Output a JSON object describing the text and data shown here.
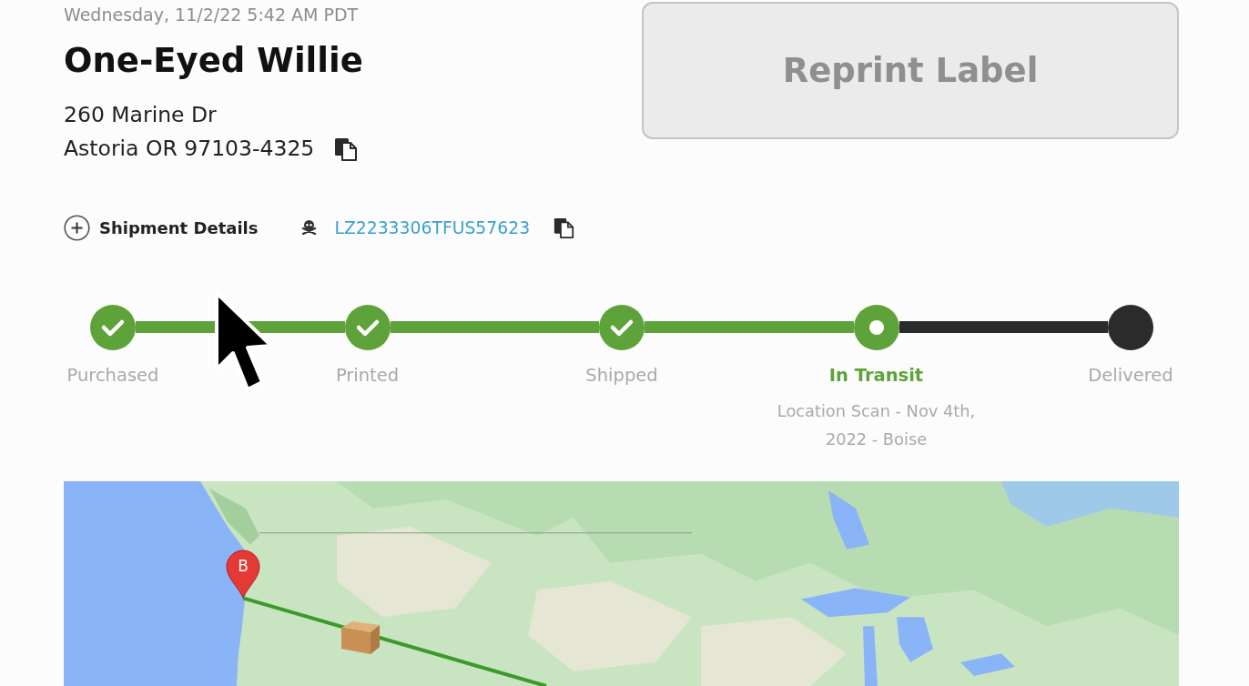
{
  "header": {
    "timestamp": "Wednesday, 11/2/22 5:42 AM PDT",
    "recipient": "One-Eyed Willie",
    "address_lines": [
      "260 Marine Dr",
      "Astoria OR 97103-4325"
    ]
  },
  "reprint_button": {
    "label": "Reprint Label",
    "disabled": true
  },
  "shipment_details": {
    "label": "Shipment Details",
    "expanded": false
  },
  "tracking_number": "LZ2233306TFUS57623",
  "progress": [
    {
      "label": "Purchased",
      "completed": true,
      "current": false
    },
    {
      "label": "Printed",
      "completed": true,
      "current": false
    },
    {
      "label": "Shipped",
      "completed": true,
      "current": false
    },
    {
      "label": "In Transit",
      "completed": false,
      "current": true,
      "detail": "Location Scan - Nov 4th, 2022 - Boise"
    },
    {
      "label": "Delivered",
      "completed": false,
      "current": false
    }
  ],
  "map": {
    "marker_label": "B"
  }
}
